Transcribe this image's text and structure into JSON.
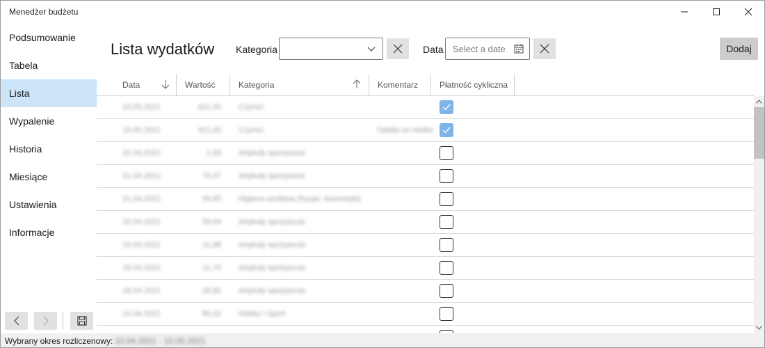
{
  "window": {
    "title": "Menedżer budżetu"
  },
  "sidebar": {
    "items": [
      {
        "label": "Podsumowanie"
      },
      {
        "label": "Tabela"
      },
      {
        "label": "Lista",
        "active": true
      },
      {
        "label": "Wypalenie"
      },
      {
        "label": "Historia"
      },
      {
        "label": "Miesiące"
      },
      {
        "label": "Ustawienia"
      },
      {
        "label": "Informacje"
      }
    ]
  },
  "header": {
    "title": "Lista wydatków",
    "category_label": "Kategoria",
    "category_value": "",
    "date_label": "Data",
    "date_placeholder": "Select a date",
    "add_label": "Dodaj"
  },
  "table": {
    "columns": [
      "Data",
      "Wartość",
      "Kategoria",
      "Komentarz",
      "Płatność cykliczna"
    ],
    "sort": {
      "Data": "descending",
      "Kategoria": "ascending"
    },
    "rows": [
      {
        "date": "10.05.2021",
        "value": "421,00",
        "category": "Czynsz",
        "comment": "",
        "recurring": true
      },
      {
        "date": "10.05.2021",
        "value": "421,00",
        "category": "Czynsz",
        "comment": "Opłata za media",
        "recurring": true
      },
      {
        "date": "22.04.2021",
        "value": "2,93",
        "category": "Artykuły spożywcze",
        "comment": "",
        "recurring": false
      },
      {
        "date": "21.04.2021",
        "value": "79,47",
        "category": "Artykuły spożywcze",
        "comment": "",
        "recurring": false
      },
      {
        "date": "21.04.2021",
        "value": "39,85",
        "category": "Higiena osobista (fryzjer, kosmetyki)",
        "comment": "",
        "recurring": false
      },
      {
        "date": "20.04.2021",
        "value": "59,94",
        "category": "Artykuły spożywcze",
        "comment": "",
        "recurring": false
      },
      {
        "date": "19.04.2021",
        "value": "11,88",
        "category": "Artykuły spożywcze",
        "comment": "",
        "recurring": false
      },
      {
        "date": "18.04.2021",
        "value": "11,70",
        "category": "Artykuły spożywcze",
        "comment": "",
        "recurring": false
      },
      {
        "date": "18.04.2021",
        "value": "28,80",
        "category": "Artykuły spożywcze",
        "comment": "",
        "recurring": false
      },
      {
        "date": "14.04.2021",
        "value": "96,22",
        "category": "Hobby / Sport",
        "comment": "",
        "recurring": false
      },
      {
        "date": "",
        "value": "",
        "category": "",
        "comment": "",
        "recurring": false
      }
    ]
  },
  "status": {
    "label": "Wybrany okres rozliczenowy:",
    "value": "10.04.2021 - 10.05.2021"
  },
  "colors": {
    "accent": "#cce4f7",
    "checkbox_checked": "#7fb4e6",
    "button_bg": "#e1e1e1"
  }
}
